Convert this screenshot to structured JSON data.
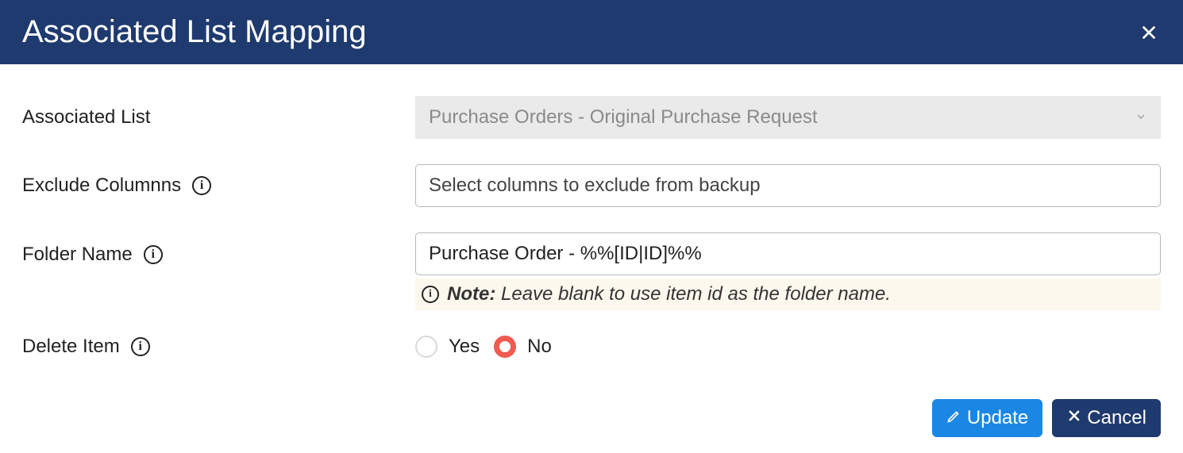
{
  "header": {
    "title": "Associated List Mapping"
  },
  "form": {
    "associated_list": {
      "label": "Associated List",
      "value": "Purchase Orders - Original Purchase Request"
    },
    "exclude_columns": {
      "label": "Exclude Columnns",
      "placeholder": "Select columns to exclude from backup"
    },
    "folder_name": {
      "label": "Folder Name",
      "value": "Purchase Order - %%[ID|ID]%%",
      "hint_prefix": "Note:",
      "hint_rest": " Leave blank to use item id as the folder name."
    },
    "delete_item": {
      "label": "Delete Item",
      "options": {
        "yes": "Yes",
        "no": "No"
      },
      "selected": "no"
    }
  },
  "buttons": {
    "update": "Update",
    "cancel": "Cancel"
  }
}
